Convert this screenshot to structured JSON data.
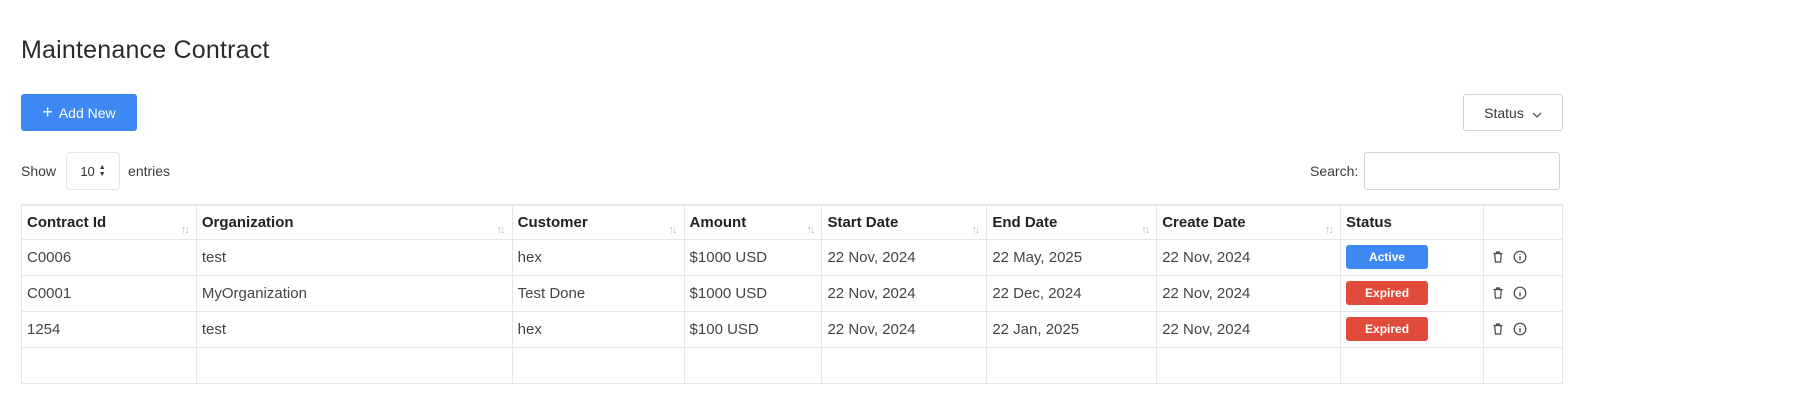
{
  "page": {
    "title": "Maintenance Contract"
  },
  "toolbar": {
    "add_label": "Add New",
    "add_icon": "plus-icon",
    "status_label": "Status",
    "status_icon": "chevron-down-icon"
  },
  "length": {
    "show_label": "Show",
    "value": "10",
    "entries_label": "entries"
  },
  "search": {
    "label": "Search:",
    "value": "",
    "placeholder": ""
  },
  "table": {
    "headers": [
      "Contract Id",
      "Organization",
      "Customer",
      "Amount",
      "Start Date",
      "End Date",
      "Create Date",
      "Status",
      ""
    ],
    "rows": [
      {
        "contract_id": "C0006",
        "organization": "test",
        "customer": "hex",
        "amount": "$1000 USD",
        "start_date": "22 Nov, 2024",
        "end_date": "22 May, 2025",
        "create_date": "22 Nov, 2024",
        "status": "Active"
      },
      {
        "contract_id": "C0001",
        "organization": "MyOrganization",
        "customer": "Test Done",
        "amount": "$1000 USD",
        "start_date": "22 Nov, 2024",
        "end_date": "22 Dec, 2024",
        "create_date": "22 Nov, 2024",
        "status": "Expired"
      },
      {
        "contract_id": "1254",
        "organization": "test",
        "customer": "hex",
        "amount": "$100 USD",
        "start_date": "22 Nov, 2024",
        "end_date": "22 Jan, 2025",
        "create_date": "22 Nov, 2024",
        "status": "Expired"
      }
    ]
  },
  "colors": {
    "primary": "#3d88f2",
    "expired": "#e04b3c",
    "border": "#e3e6ea"
  },
  "icons": {
    "delete": "trash-icon",
    "info": "info-icon",
    "sort": "sort-icon"
  }
}
